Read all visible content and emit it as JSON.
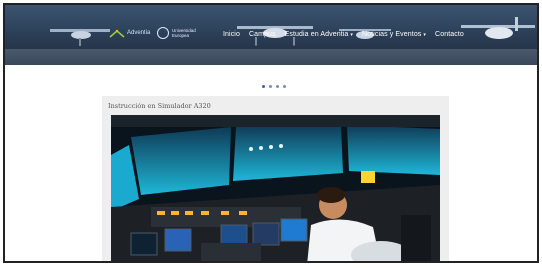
{
  "header": {
    "brand_text": "Adventia",
    "badge_text": "Universidad Europea",
    "nav": [
      {
        "label": "Inicio"
      },
      {
        "label": "Campus"
      },
      {
        "label": "Estudia en Adventia",
        "dropdown": true
      },
      {
        "label": "Noticias y Eventos",
        "dropdown": true
      },
      {
        "label": "Contacto"
      }
    ]
  },
  "carousel": {
    "slides": 4,
    "active_index": 0
  },
  "card": {
    "title": "Instrucción en Simulador A320"
  },
  "colors": {
    "header_bg": "#2a3c54",
    "accent": "#3d5fa8",
    "card_bg": "#eeeeee"
  },
  "icons": [
    "chevron-down-icon",
    "logo-icon"
  ]
}
